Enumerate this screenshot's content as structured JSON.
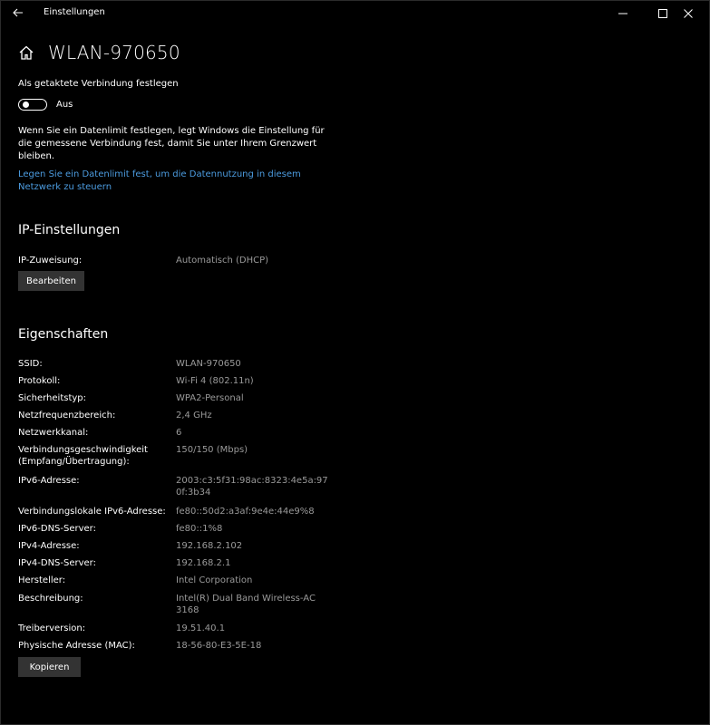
{
  "window": {
    "app_title": "Einstellungen"
  },
  "header": {
    "title": "WLAN-970650"
  },
  "metered": {
    "label": "Als getaktete Verbindung festlegen",
    "toggle_state": "Aus",
    "description": "Wenn Sie ein Datenlimit festlegen, legt Windows die Einstellung für die gemessene Verbindung fest, damit Sie unter Ihrem Grenzwert bleiben.",
    "link": "Legen Sie ein Datenlimit fest, um die Datennutzung in diesem Netzwerk zu steuern"
  },
  "ip_settings": {
    "title": "IP-Einstellungen",
    "assignment_label": "IP-Zuweisung:",
    "assignment_value": "Automatisch (DHCP)",
    "edit_button": "Bearbeiten"
  },
  "properties": {
    "title": "Eigenschaften",
    "rows": [
      {
        "key": "SSID:",
        "value": "WLAN-970650"
      },
      {
        "key": "Protokoll:",
        "value": "Wi-Fi 4 (802.11n)"
      },
      {
        "key": "Sicherheitstyp:",
        "value": "WPA2-Personal"
      },
      {
        "key": "Netzfrequenzbereich:",
        "value": "2,4 GHz"
      },
      {
        "key": "Netzwerkkanal:",
        "value": "6"
      },
      {
        "key": "Verbindungsgeschwindigkeit (Empfang/Übertragung):",
        "value": "150/150 (Mbps)"
      },
      {
        "key": "IPv6-Adresse:",
        "value": "2003:c3:5f31:98ac:8323:4e5a:970f:3b34"
      },
      {
        "key": "Verbindungslokale IPv6-Adresse:",
        "value": "fe80::50d2:a3af:9e4e:44e9%8"
      },
      {
        "key": "IPv6-DNS-Server:",
        "value": "fe80::1%8"
      },
      {
        "key": "IPv4-Adresse:",
        "value": "192.168.2.102"
      },
      {
        "key": "IPv4-DNS-Server:",
        "value": "192.168.2.1"
      },
      {
        "key": "Hersteller:",
        "value": "Intel Corporation"
      },
      {
        "key": "Beschreibung:",
        "value": "Intel(R) Dual Band Wireless-AC 3168"
      },
      {
        "key": "Treiberversion:",
        "value": "19.51.40.1"
      },
      {
        "key": "Physische Adresse (MAC):",
        "value": "18-56-80-E3-5E-18"
      }
    ],
    "copy_button": "Kopieren"
  },
  "colors": {
    "background": "#000000",
    "link": "#4c9ce0",
    "value_text": "#9a9a9a",
    "button_bg": "#333333"
  }
}
